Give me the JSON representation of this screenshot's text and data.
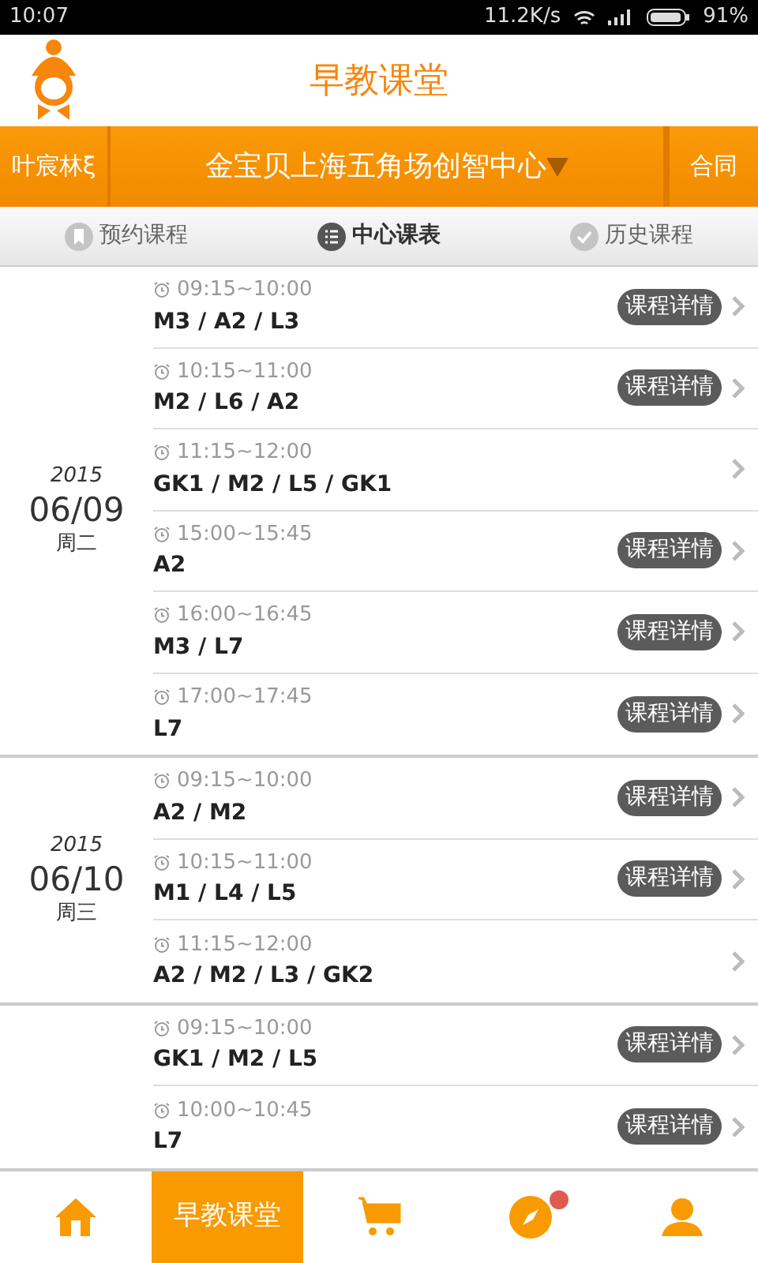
{
  "status_bar": {
    "time": "10:07",
    "speed": "11.2K/s",
    "battery": "91%"
  },
  "header": {
    "title": "早教课堂"
  },
  "center_bar": {
    "child": "叶宸林ξ",
    "center": "金宝贝上海五角场创智中心",
    "contract": "合同"
  },
  "tabs": [
    {
      "label": "预约课程",
      "kind": "bookmark",
      "selected": false
    },
    {
      "label": "中心课表",
      "kind": "list",
      "selected": true
    },
    {
      "label": "历史课程",
      "kind": "check",
      "selected": false
    }
  ],
  "days": [
    {
      "year": "2015",
      "date": "06/09",
      "weekday": "周二",
      "sessions": [
        {
          "time": "09:15~10:00",
          "courses": "M3 / A2 / L3",
          "detail": "课程详情"
        },
        {
          "time": "10:15~11:00",
          "courses": "M2 / L6 / A2",
          "detail": "课程详情"
        },
        {
          "time": "11:15~12:00",
          "courses": "GK1 / M2 / L5 / GK1"
        },
        {
          "time": "15:00~15:45",
          "courses": "A2",
          "detail": "课程详情"
        },
        {
          "time": "16:00~16:45",
          "courses": "M3 / L7",
          "detail": "课程详情"
        },
        {
          "time": "17:00~17:45",
          "courses": "L7",
          "detail": "课程详情"
        }
      ]
    },
    {
      "year": "2015",
      "date": "06/10",
      "weekday": "周三",
      "sessions": [
        {
          "time": "09:15~10:00",
          "courses": "A2 / M2",
          "detail": "课程详情"
        },
        {
          "time": "10:15~11:00",
          "courses": "M1 / L4 / L5",
          "detail": "课程详情"
        },
        {
          "time": "11:15~12:00",
          "courses": "A2 / M2 / L3 / GK2"
        }
      ]
    },
    {
      "sessions": [
        {
          "time": "09:15~10:00",
          "courses": "GK1 / M2 / L5",
          "detail": "课程详情"
        },
        {
          "time": "10:00~10:45",
          "courses": "L7",
          "detail": "课程详情"
        }
      ]
    }
  ],
  "bottom_nav": [
    {
      "kind": "home",
      "selected": false
    },
    {
      "kind": "text",
      "label": "早教课堂",
      "selected": true
    },
    {
      "kind": "cart",
      "selected": false
    },
    {
      "kind": "compass",
      "selected": false,
      "badge": true
    },
    {
      "kind": "person",
      "selected": false
    }
  ]
}
